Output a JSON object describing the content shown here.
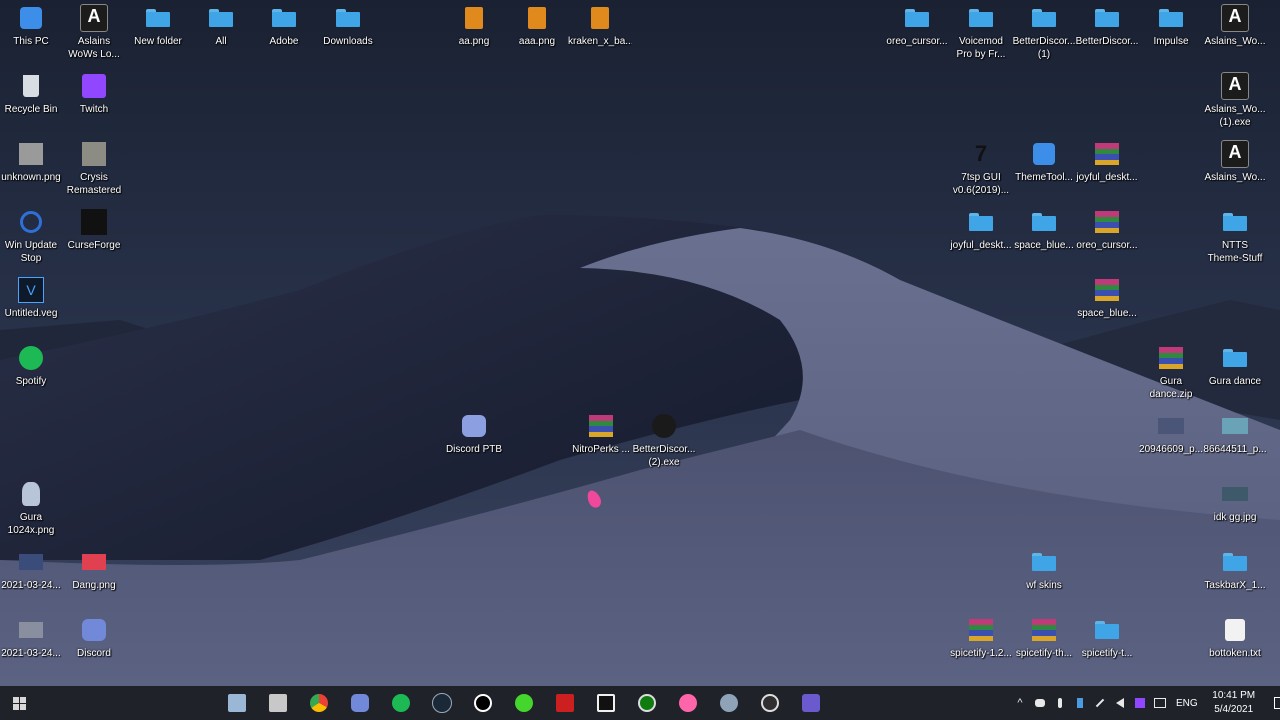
{
  "desktop": {
    "icons_left": [
      {
        "label": "This PC",
        "icon": "computer-icon"
      },
      {
        "label": "Aslains\nWoWs Lo...",
        "icon": "aslains-icon"
      },
      {
        "label": "New folder",
        "icon": "folder-icon"
      },
      {
        "label": "All",
        "icon": "folder-icon"
      },
      {
        "label": "Adobe",
        "icon": "folder-icon"
      },
      {
        "label": "Downloads",
        "icon": "folder-icon"
      },
      {
        "label": "Recycle Bin",
        "icon": "recycle-bin-icon"
      },
      {
        "label": "Twitch",
        "icon": "twitch-icon"
      },
      {
        "label": "unknown.png",
        "icon": "image-icon"
      },
      {
        "label": "Crysis\nRemastered",
        "icon": "crysis-icon"
      },
      {
        "label": "Win Update\nStop",
        "icon": "update-stop-icon"
      },
      {
        "label": "CurseForge",
        "icon": "curseforge-icon"
      },
      {
        "label": "Untitled.veg",
        "icon": "vegas-icon"
      },
      {
        "label": "Spotify",
        "icon": "spotify-icon"
      },
      {
        "label": "Gura\n1024x.png",
        "icon": "image-icon"
      },
      {
        "label": "2021-03-24...",
        "icon": "image-icon"
      },
      {
        "label": "Dang.png",
        "icon": "image-icon"
      },
      {
        "label": "2021-03-24...",
        "icon": "image-icon"
      },
      {
        "label": "Discord",
        "icon": "discord-icon"
      }
    ],
    "icons_top_center": [
      {
        "label": "aa.png",
        "icon": "orange-file-icon"
      },
      {
        "label": "aaa.png",
        "icon": "orange-file-icon"
      },
      {
        "label": "kraken_x_ba...",
        "icon": "orange-file-icon"
      }
    ],
    "icons_middle": [
      {
        "label": "Discord PTB",
        "icon": "discord-icon"
      },
      {
        "label": "NitroPerks ...",
        "icon": "archive-icon"
      },
      {
        "label": "BetterDiscor...\n(2).exe",
        "icon": "betterdiscord-icon"
      }
    ],
    "icons_right": [
      {
        "label": "oreo_cursor...",
        "icon": "folder-icon"
      },
      {
        "label": "Voicemod\nPro by Fr...",
        "icon": "folder-icon"
      },
      {
        "label": "BetterDiscor...\n(1)",
        "icon": "folder-icon"
      },
      {
        "label": "BetterDiscor...",
        "icon": "folder-icon"
      },
      {
        "label": "Impulse",
        "icon": "folder-icon"
      },
      {
        "label": "Aslains_Wo...",
        "icon": "aslains-icon"
      },
      {
        "label": "Aslains_Wo...\n(1).exe",
        "icon": "aslains-icon"
      },
      {
        "label": "7tsp GUI\nv0.6(2019)...",
        "icon": "seventsp-icon"
      },
      {
        "label": "ThemeTool...",
        "icon": "themetool-icon"
      },
      {
        "label": "joyful_deskt...",
        "icon": "archive-icon"
      },
      {
        "label": "Aslains_Wo...",
        "icon": "aslains-icon"
      },
      {
        "label": "joyful_deskt...",
        "icon": "folder-icon"
      },
      {
        "label": "space_blue...",
        "icon": "folder-icon"
      },
      {
        "label": "oreo_cursor...",
        "icon": "archive-icon"
      },
      {
        "label": "NTTS\nTheme-Stuff",
        "icon": "folder-icon"
      },
      {
        "label": "space_blue...",
        "icon": "archive-icon"
      },
      {
        "label": "Gura\ndance.zip",
        "icon": "archive-icon"
      },
      {
        "label": "Gura dance",
        "icon": "folder-icon"
      },
      {
        "label": "20946609_p...",
        "icon": "image-icon"
      },
      {
        "label": "86644511_p...",
        "icon": "image-icon"
      },
      {
        "label": "idk gg.jpg",
        "icon": "image-icon"
      },
      {
        "label": "wf skins",
        "icon": "folder-icon"
      },
      {
        "label": "TaskbarX_1...",
        "icon": "folder-icon"
      },
      {
        "label": "spicetify-1.2...",
        "icon": "archive-icon"
      },
      {
        "label": "spicetify-th...",
        "icon": "archive-icon"
      },
      {
        "label": "spicetify-t...",
        "icon": "folder-icon"
      },
      {
        "label": "bottoken.txt",
        "icon": "text-file-icon"
      }
    ]
  },
  "taskbar": {
    "pinned": [
      {
        "name": "file-explorer",
        "icon": "file-explorer-icon",
        "color": "#9ab8d6"
      },
      {
        "name": "printer",
        "icon": "printer-icon",
        "color": "#c8c8c8"
      },
      {
        "name": "chrome",
        "icon": "chrome-icon",
        "color": "#e94235"
      },
      {
        "name": "discord",
        "icon": "discord-icon",
        "color": "#7289da"
      },
      {
        "name": "spotify",
        "icon": "spotify-icon",
        "color": "#1db954"
      },
      {
        "name": "steam",
        "icon": "steam-icon",
        "color": "#1b2838"
      },
      {
        "name": "logitech",
        "icon": "logitech-icon",
        "color": "#ffffff"
      },
      {
        "name": "razer",
        "icon": "razer-icon",
        "color": "#44d62c"
      },
      {
        "name": "adobe-flash",
        "icon": "flash-icon",
        "color": "#cc1f1f"
      },
      {
        "name": "epic-games",
        "icon": "epic-icon",
        "color": "#f0f0f0"
      },
      {
        "name": "xbox",
        "icon": "xbox-icon",
        "color": "#107c10"
      },
      {
        "name": "osu",
        "icon": "osu-icon",
        "color": "#ff66aa"
      },
      {
        "name": "app-circle",
        "icon": "circle-app-icon",
        "color": "#8fa3b8"
      },
      {
        "name": "obs",
        "icon": "obs-icon",
        "color": "#302e31"
      },
      {
        "name": "app-badge",
        "icon": "app-badge-icon",
        "color": "#6a5acd"
      }
    ],
    "tray": {
      "language": "ENG",
      "time": "10:41 PM",
      "date": "5/4/2021"
    }
  }
}
